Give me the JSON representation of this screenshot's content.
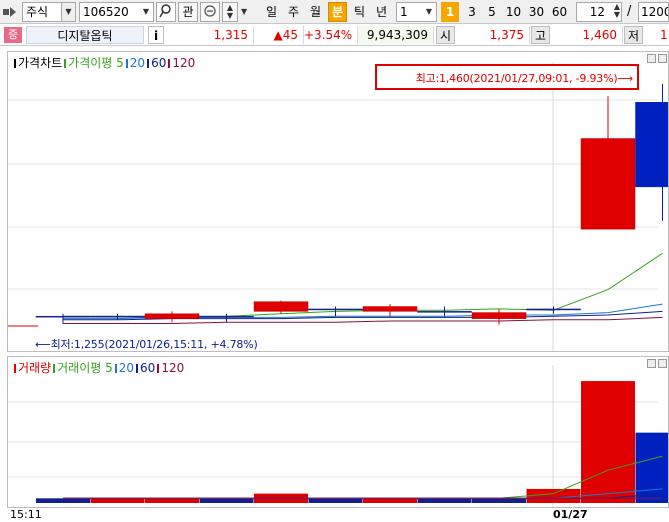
{
  "toolbar": {
    "market_select": "주식",
    "code_input": "106520",
    "search_icon": "search-icon",
    "favorite_label": "관",
    "periods": [
      {
        "label": "일",
        "active": false
      },
      {
        "label": "주",
        "active": false
      },
      {
        "label": "월",
        "active": false
      },
      {
        "label": "분",
        "active": true
      },
      {
        "label": "틱",
        "active": false
      },
      {
        "label": "년",
        "active": false
      }
    ],
    "interval_select": "1",
    "minute_buttons": [
      {
        "label": "1",
        "active": true
      },
      {
        "label": "3",
        "active": false
      },
      {
        "label": "5",
        "active": false
      },
      {
        "label": "10",
        "active": false
      },
      {
        "label": "30",
        "active": false
      },
      {
        "label": "60",
        "active": false
      }
    ],
    "count_value": "12",
    "count_separator": "/",
    "count_total": "1200"
  },
  "quote": {
    "logo": "증",
    "name": "디지탈옵틱",
    "info_button": "i",
    "price": "1,315",
    "change": "▲45",
    "change_rate": "+3.54%",
    "volume": "9,943,309",
    "open_label": "시",
    "open": "1,375",
    "high_label": "고",
    "high": "1,460",
    "low_label": "저",
    "low": "1"
  },
  "price_panel": {
    "legend": [
      {
        "label": "가격차트",
        "color": "#000000"
      },
      {
        "label": "가격이평 5",
        "color": "#3aa21f"
      },
      {
        "label": "20",
        "color": "#1e78c8"
      },
      {
        "label": "60",
        "color": "#102090"
      },
      {
        "label": "120",
        "color": "#8a1040"
      }
    ],
    "high_annotation": "최고:1,460(2021/01/27,09:01, -9.93%)⟶",
    "low_annotation": "⟵최저:1,255(2021/01/26,15:11, +4.78%)"
  },
  "volume_panel": {
    "legend": [
      {
        "label": "거래량",
        "color": "#e00000"
      },
      {
        "label": "거래이평 5",
        "color": "#3aa21f"
      },
      {
        "label": "20",
        "color": "#1e78c8"
      },
      {
        "label": "60",
        "color": "#102090"
      },
      {
        "label": "120",
        "color": "#8a1040"
      }
    ]
  },
  "time_axis": {
    "left_label": "15:11",
    "date_label": "01/27"
  },
  "chart_data": {
    "type": "candlestick",
    "time_labels": [
      "15:11",
      "01/27"
    ],
    "candles": [
      {
        "open": 1268,
        "close": 1268,
        "high": 1270,
        "low": 1262,
        "direction": "flat"
      },
      {
        "open": 1268,
        "close": 1268,
        "high": 1270,
        "low": 1265,
        "direction": "flat"
      },
      {
        "open": 1266,
        "close": 1270,
        "high": 1272,
        "low": 1263,
        "direction": "up"
      },
      {
        "open": 1268,
        "close": 1268,
        "high": 1270,
        "low": 1263,
        "direction": "flat"
      },
      {
        "open": 1272,
        "close": 1280,
        "high": 1281,
        "low": 1270,
        "direction": "up"
      },
      {
        "open": 1274,
        "close": 1274,
        "high": 1276,
        "low": 1268,
        "direction": "flat"
      },
      {
        "open": 1272,
        "close": 1276,
        "high": 1278,
        "low": 1268,
        "direction": "up"
      },
      {
        "open": 1272,
        "close": 1272,
        "high": 1276,
        "low": 1268,
        "direction": "flat"
      },
      {
        "open": 1266,
        "close": 1271,
        "high": 1274,
        "low": 1261,
        "direction": "up"
      },
      {
        "open": 1274,
        "close": 1274,
        "high": 1276,
        "low": 1270,
        "direction": "flat"
      },
      {
        "open": 1340,
        "close": 1415,
        "high": 1450,
        "low": 1405,
        "direction": "up"
      },
      {
        "open": 1445,
        "close": 1375,
        "high": 1460,
        "low": 1347,
        "direction": "down"
      }
    ],
    "price_ma": [
      {
        "name": "가격이평 5",
        "color": "#3aa21f",
        "values": [
          1268,
          1268,
          1268,
          1268,
          1270,
          1272,
          1273,
          1273,
          1274,
          1273,
          1290,
          1320
        ]
      },
      {
        "name": "20",
        "color": "#1e78c8",
        "values": [
          1266,
          1266,
          1267,
          1267,
          1267,
          1268,
          1268,
          1268,
          1269,
          1269,
          1271,
          1278
        ]
      },
      {
        "name": "60",
        "color": "#102090",
        "values": [
          1265,
          1265,
          1266,
          1266,
          1266,
          1267,
          1267,
          1267,
          1267,
          1268,
          1269,
          1272
        ]
      },
      {
        "name": "120",
        "color": "#8a1040",
        "values": [
          1262,
          1262,
          1262,
          1263,
          1263,
          1263,
          1264,
          1264,
          1264,
          1265,
          1265,
          1267
        ]
      }
    ],
    "volume": {
      "values": [
        1,
        1,
        1,
        1,
        2,
        1,
        1,
        1,
        1,
        3,
        26,
        15
      ],
      "colors": [
        "#102090",
        "#e00000",
        "#e00000",
        "#102090",
        "#e00000",
        "#102090",
        "#e00000",
        "#102090",
        "#102090",
        "#e00000",
        "#e00000",
        "#0020c0"
      ]
    },
    "volume_ma": [
      {
        "name": "거래이평 5",
        "color": "#3aa21f",
        "values": [
          1,
          1,
          1,
          1,
          1,
          1,
          1,
          1,
          1,
          2,
          7,
          10
        ]
      },
      {
        "name": "20",
        "color": "#1e78c8",
        "values": [
          1,
          1,
          1,
          1,
          1,
          1,
          1,
          1,
          1,
          1,
          2,
          3
        ]
      },
      {
        "name": "60",
        "color": "#102090",
        "values": [
          1,
          1,
          1,
          1,
          1,
          1,
          1,
          1,
          1,
          1,
          1,
          2
        ]
      },
      {
        "name": "120",
        "color": "#8a1040",
        "values": [
          1,
          1,
          1,
          1,
          1,
          1,
          1,
          1,
          1,
          1,
          1,
          1
        ]
      }
    ],
    "price_range": [
      1245,
      1475
    ],
    "volume_range": [
      0,
      29
    ],
    "grid": true
  }
}
